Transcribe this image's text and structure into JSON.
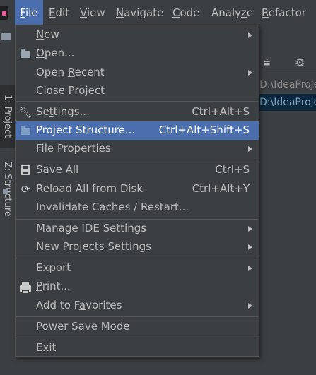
{
  "menubar": {
    "items": [
      {
        "label": "File",
        "mnemonic": "F",
        "rest": "ile"
      },
      {
        "label": "Edit",
        "mnemonic": "E",
        "rest": "dit"
      },
      {
        "label": "View",
        "mnemonic": "V",
        "rest": "iew"
      },
      {
        "label": "Navigate",
        "mnemonic": "N",
        "rest": "avigate"
      },
      {
        "label": "Code",
        "mnemonic": "C",
        "rest": "ode"
      },
      {
        "label": "Analyze",
        "pre": "Analy",
        "mnemonic": "z",
        "rest": "e"
      },
      {
        "label": "Refactor",
        "mnemonic": "R",
        "rest": "efactor"
      }
    ]
  },
  "sidebar": {
    "project_tab": "1: Project",
    "structure_tab": "Z: Structure"
  },
  "background": {
    "tree_rows": [
      "D:\\IdeaProje",
      "D:\\IdeaProje"
    ]
  },
  "file_menu": {
    "items": [
      {
        "pre": "",
        "mn": "N",
        "post": "ew",
        "shortcut": "",
        "submenu": true,
        "icon": ""
      },
      {
        "pre": "",
        "mn": "O",
        "post": "pen...",
        "shortcut": "",
        "submenu": false,
        "icon": "open-folder-icon"
      },
      {
        "pre": "Open ",
        "mn": "R",
        "post": "ecent",
        "shortcut": "",
        "submenu": true,
        "icon": ""
      },
      {
        "pre": "Close Project",
        "mn": "",
        "post": "",
        "shortcut": "",
        "submenu": false,
        "icon": ""
      },
      {
        "pre": "Se",
        "mn": "t",
        "post": "tings...",
        "shortcut": "Ctrl+Alt+S",
        "submenu": false,
        "icon": "wrench-icon"
      },
      {
        "pre": "Project Structure...",
        "mn": "",
        "post": "",
        "shortcut": "Ctrl+Alt+Shift+S",
        "submenu": false,
        "icon": "project-structure-icon"
      },
      {
        "pre": "File Properties",
        "mn": "",
        "post": "",
        "shortcut": "",
        "submenu": true,
        "icon": ""
      },
      {
        "pre": "",
        "mn": "S",
        "post": "ave All",
        "shortcut": "Ctrl+S",
        "submenu": false,
        "icon": "save-icon"
      },
      {
        "pre": "Reload All from Disk",
        "mn": "",
        "post": "",
        "shortcut": "Ctrl+Alt+Y",
        "submenu": false,
        "icon": "reload-icon"
      },
      {
        "pre": "Invalidate Caches / Restart...",
        "mn": "",
        "post": "",
        "shortcut": "",
        "submenu": false,
        "icon": ""
      },
      {
        "pre": "Manage IDE Settings",
        "mn": "",
        "post": "",
        "shortcut": "",
        "submenu": true,
        "icon": ""
      },
      {
        "pre": "New Projects Settings",
        "mn": "",
        "post": "",
        "shortcut": "",
        "submenu": true,
        "icon": ""
      },
      {
        "pre": "Export",
        "mn": "",
        "post": "",
        "shortcut": "",
        "submenu": true,
        "icon": ""
      },
      {
        "pre": "",
        "mn": "P",
        "post": "rint...",
        "shortcut": "",
        "submenu": false,
        "icon": "print-icon"
      },
      {
        "pre": "Add to F",
        "mn": "a",
        "post": "vorites",
        "shortcut": "",
        "submenu": true,
        "icon": ""
      },
      {
        "pre": "Power Save Mode",
        "mn": "",
        "post": "",
        "shortcut": "",
        "submenu": false,
        "icon": ""
      },
      {
        "pre": "E",
        "mn": "x",
        "post": "it",
        "shortcut": "",
        "submenu": false,
        "icon": ""
      }
    ],
    "highlighted_index": 5
  },
  "colors": {
    "menubar_bg": "#3c3f41",
    "highlight": "#4b6eaf",
    "text": "#bbbbbb",
    "separator": "#555555"
  }
}
